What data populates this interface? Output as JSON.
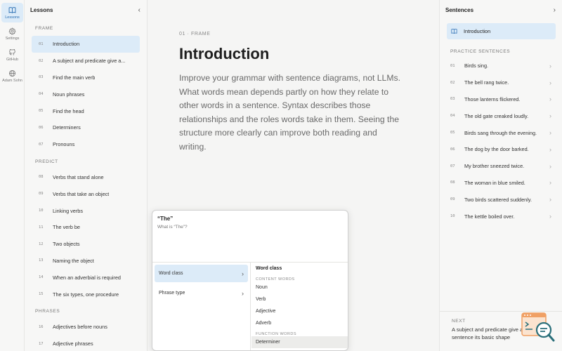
{
  "rail": [
    {
      "label": "Lessons",
      "icon": "book-icon",
      "active": true
    },
    {
      "label": "Settings",
      "icon": "gear-icon"
    },
    {
      "label": "GitHub",
      "icon": "github-icon"
    },
    {
      "label": "Adam Sohn",
      "icon": "globe-icon"
    }
  ],
  "lessons": {
    "title": "Lessons",
    "sections": [
      {
        "label": "FRAME",
        "items": [
          {
            "num": "01",
            "text": "Introduction",
            "active": true
          },
          {
            "num": "02",
            "text": "A subject and predicate give a..."
          },
          {
            "num": "03",
            "text": "Find the main verb"
          },
          {
            "num": "04",
            "text": "Noun phrases"
          },
          {
            "num": "05",
            "text": "Find the head"
          },
          {
            "num": "06",
            "text": "Determiners"
          },
          {
            "num": "07",
            "text": "Pronouns"
          }
        ]
      },
      {
        "label": "PREDICT",
        "items": [
          {
            "num": "08",
            "text": "Verbs that stand alone"
          },
          {
            "num": "09",
            "text": "Verbs that take an object"
          },
          {
            "num": "10",
            "text": "Linking verbs"
          },
          {
            "num": "11",
            "text": "The verb be"
          },
          {
            "num": "12",
            "text": "Two objects"
          },
          {
            "num": "13",
            "text": "Naming the object"
          },
          {
            "num": "14",
            "text": "When an adverbial is required"
          },
          {
            "num": "15",
            "text": "The six types, one procedure"
          }
        ]
      },
      {
        "label": "PHRASES",
        "items": [
          {
            "num": "16",
            "text": "Adjectives before nouns"
          },
          {
            "num": "17",
            "text": "Adjective phrases"
          }
        ]
      }
    ]
  },
  "main": {
    "kicker": "01 · FRAME",
    "title": "Introduction",
    "body": "Improve your grammar with sentence diagrams, not LLMs. What words mean depends partly on how they relate to other words in a sentence. Syntax describes those relationships and the roles words take in them. Seeing the structure more clearly can improve both reading and writing."
  },
  "popup": {
    "word": "“The”",
    "question": "What is “The”?",
    "options": [
      {
        "label": "Word class",
        "active": true
      },
      {
        "label": "Phrase type"
      }
    ],
    "panel_title": "Word class",
    "content_label": "CONTENT WORDS",
    "content_words": [
      "Noun",
      "Verb",
      "Adjective",
      "Adverb"
    ],
    "function_label": "FUNCTION WORDS",
    "function_words": [
      "Determiner"
    ]
  },
  "sentences": {
    "title": "Sentences",
    "intro": "Introduction",
    "section_label": "PRACTICE SENTENCES",
    "items": [
      {
        "num": "01",
        "text": "Birds sing."
      },
      {
        "num": "02",
        "text": "The bell rang twice."
      },
      {
        "num": "03",
        "text": "Those lanterns flickered."
      },
      {
        "num": "04",
        "text": "The old gate creaked loudly."
      },
      {
        "num": "05",
        "text": "Birds sang through the evening."
      },
      {
        "num": "06",
        "text": "The dog by the door barked."
      },
      {
        "num": "07",
        "text": "My brother sneezed twice."
      },
      {
        "num": "08",
        "text": "The woman in blue smiled."
      },
      {
        "num": "09",
        "text": "Two birds scattered suddenly."
      },
      {
        "num": "10",
        "text": "The kettle boiled over."
      }
    ],
    "next_label": "NEXT",
    "next_text": "A subject and predicate give a sentence its basic shape"
  },
  "colors": {
    "accent_bg": "#dcebf8",
    "accent": "#2c6fb3",
    "widget_orange": "#f0a064",
    "widget_teal": "#2a6f7a"
  }
}
